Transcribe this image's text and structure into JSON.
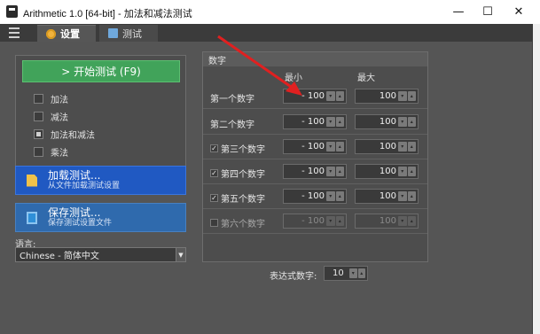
{
  "window": {
    "title": "Arithmetic 1.0  [64-bit] - 加法和减法测试",
    "controls": {
      "minimize": "—",
      "maximize": "☐",
      "close": "✕"
    }
  },
  "tabs": [
    {
      "label": "设置",
      "icon": "gear-icon",
      "active": true
    },
    {
      "label": "测试",
      "icon": "calculator-icon",
      "active": false
    }
  ],
  "left_panel": {
    "start_button": "> 开始测试 (F9)",
    "options": [
      {
        "label": "加法",
        "state": "unchecked"
      },
      {
        "label": "减法",
        "state": "unchecked"
      },
      {
        "label": "加法和减法",
        "state": "partial"
      },
      {
        "label": "乘法",
        "state": "unchecked"
      }
    ],
    "load_button": {
      "title": "加载测试...",
      "subtitle": "从文件加载测试设置",
      "icon": "document-icon"
    },
    "save_button": {
      "title": "保存测试...",
      "subtitle": "保存测试设置文件",
      "icon": "save-icon"
    },
    "language_label": "语言:",
    "language_value": "Chinese - 简体中文"
  },
  "numbers_panel": {
    "header": "数字",
    "col_min": "最小",
    "col_max": "最大",
    "rows": [
      {
        "label": "第一个数字",
        "checkbox": null,
        "min": "- 100",
        "max": "100",
        "enabled": true
      },
      {
        "label": "第二个数字",
        "checkbox": null,
        "min": "- 100",
        "max": "100",
        "enabled": true
      },
      {
        "label": "第三个数字",
        "checkbox": "checked",
        "min": "- 100",
        "max": "100",
        "enabled": true
      },
      {
        "label": "第四个数字",
        "checkbox": "checked",
        "min": "- 100",
        "max": "100",
        "enabled": true
      },
      {
        "label": "第五个数字",
        "checkbox": "checked",
        "min": "- 100",
        "max": "100",
        "enabled": true
      },
      {
        "label": "第六个数字",
        "checkbox": "unchecked",
        "min": "- 100",
        "max": "100",
        "enabled": false
      }
    ],
    "expr_label": "表达式数字:",
    "expr_value": "10"
  },
  "colors": {
    "start_green": "#41a35a",
    "load_blue": "#2059c2",
    "save_blue": "#2f6aad",
    "arrow_red": "#e02020"
  }
}
